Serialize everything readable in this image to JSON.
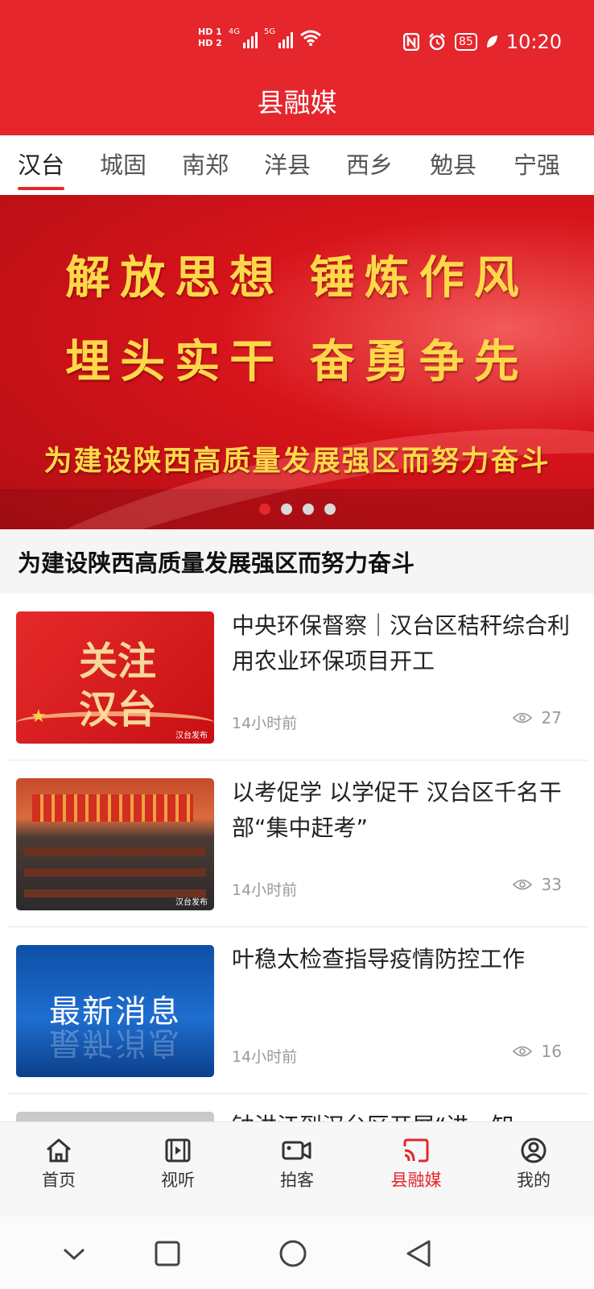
{
  "status_bar": {
    "hd1": "HD 1",
    "hd2": "HD 2",
    "net1": "4G",
    "net2": "5G",
    "battery": "85",
    "time": "10:20",
    "icons": [
      "nfc-icon",
      "alarm-icon",
      "battery-icon",
      "leaf-icon",
      "wifi-icon",
      "signal-icon"
    ]
  },
  "header": {
    "title": "县融媒"
  },
  "tabs": [
    "汉台",
    "城固",
    "南郑",
    "洋县",
    "西乡",
    "勉县",
    "宁强"
  ],
  "active_tab": "汉台",
  "banner": {
    "line1": "解放思想 锤炼作风",
    "line2": "埋头实干 奋勇争先",
    "line3": "为建设陕西高质量发展强区而努力奋斗",
    "dots": 4,
    "active_dot": 1,
    "caption": "为建设陕西高质量发展强区而努力奋斗"
  },
  "news": [
    {
      "title": "中央环保督察｜汉台区秸秆综合利用农业环保项目开工",
      "time": "14小时前",
      "views": "27",
      "thumb_text1": "关注",
      "thumb_text2": "汉台",
      "thumb_mark": "汉台发布"
    },
    {
      "title": "以考促学 以学促干 汉台区千名干部“集中赶考”",
      "time": "14小时前",
      "views": "33",
      "thumb_mark": "汉台发布"
    },
    {
      "title": "叶稳太检查指导疫情防控工作",
      "time": "14小时前",
      "views": "16",
      "thumb_text1": "最新消息"
    },
    {
      "title": "钟洪江到汉台区开展“进、知、"
    }
  ],
  "bottom_nav": [
    {
      "label": "首页",
      "icon": "home-icon"
    },
    {
      "label": "视听",
      "icon": "film-icon"
    },
    {
      "label": "拍客",
      "icon": "camera-icon"
    },
    {
      "label": "县融媒",
      "icon": "cast-icon"
    },
    {
      "label": "我的",
      "icon": "user-icon"
    }
  ],
  "active_nav": "县融媒",
  "colors": {
    "brand_red": "#e5262d",
    "gold": "#ffd84a",
    "muted": "#999999"
  }
}
